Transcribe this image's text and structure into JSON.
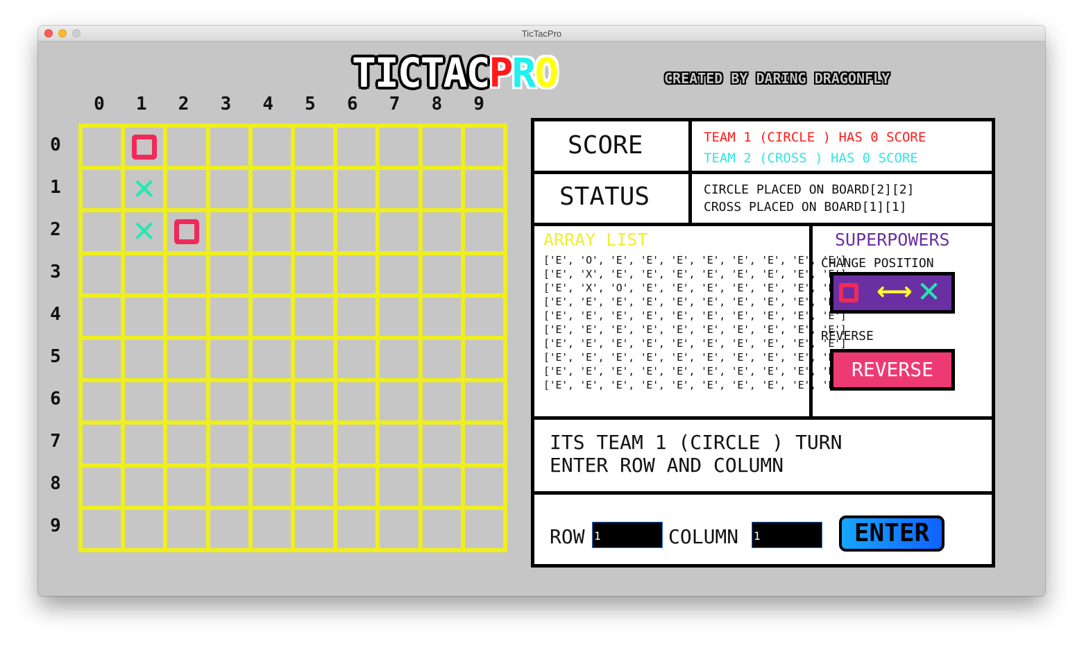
{
  "window": {
    "title": "TicTacPro"
  },
  "header": {
    "logo_tictac": "TICTAC",
    "logo_p": "P",
    "logo_r": "R",
    "logo_o": "O",
    "credit": "CREATED BY DARING DRAGONFLY"
  },
  "board": {
    "col_labels": [
      "0",
      "1",
      "2",
      "3",
      "4",
      "5",
      "6",
      "7",
      "8",
      "9"
    ],
    "row_labels": [
      "0",
      "1",
      "2",
      "3",
      "4",
      "5",
      "6",
      "7",
      "8",
      "9"
    ],
    "cells": [
      [
        "E",
        "O",
        "E",
        "E",
        "E",
        "E",
        "E",
        "E",
        "E",
        "E"
      ],
      [
        "E",
        "X",
        "E",
        "E",
        "E",
        "E",
        "E",
        "E",
        "E",
        "E"
      ],
      [
        "E",
        "X",
        "O",
        "E",
        "E",
        "E",
        "E",
        "E",
        "E",
        "E"
      ],
      [
        "E",
        "E",
        "E",
        "E",
        "E",
        "E",
        "E",
        "E",
        "E",
        "E"
      ],
      [
        "E",
        "E",
        "E",
        "E",
        "E",
        "E",
        "E",
        "E",
        "E",
        "E"
      ],
      [
        "E",
        "E",
        "E",
        "E",
        "E",
        "E",
        "E",
        "E",
        "E",
        "E"
      ],
      [
        "E",
        "E",
        "E",
        "E",
        "E",
        "E",
        "E",
        "E",
        "E",
        "E"
      ],
      [
        "E",
        "E",
        "E",
        "E",
        "E",
        "E",
        "E",
        "E",
        "E",
        "E"
      ],
      [
        "E",
        "E",
        "E",
        "E",
        "E",
        "E",
        "E",
        "E",
        "E",
        "E"
      ],
      [
        "E",
        "E",
        "E",
        "E",
        "E",
        "E",
        "E",
        "E",
        "E",
        "E"
      ]
    ],
    "grid_color": "#efef1e",
    "circle_color": "#ef2a5a",
    "cross_color": "#22e8b0"
  },
  "score": {
    "label": "SCORE",
    "team1": "TEAM 1 (CIRCLE ) HAS 0 SCORE",
    "team2": "TEAM 2 (CROSS ) HAS 0 SCORE"
  },
  "status": {
    "label": "STATUS",
    "line1": "CIRCLE PLACED ON BOARD[2][2]",
    "line2": "CROSS PLACED ON BOARD[1][1]"
  },
  "array_list": {
    "title": "ARRAY LIST",
    "rows": [
      "['E', 'O', 'E', 'E', 'E', 'E', 'E', 'E', 'E', 'E']",
      "['E', 'X', 'E', 'E', 'E', 'E', 'E', 'E', 'E', 'E']",
      "['E', 'X', 'O', 'E', 'E', 'E', 'E', 'E', 'E', 'E']",
      "['E', 'E', 'E', 'E', 'E', 'E', 'E', 'E', 'E', 'E']",
      "['E', 'E', 'E', 'E', 'E', 'E', 'E', 'E', 'E', 'E']",
      "['E', 'E', 'E', 'E', 'E', 'E', 'E', 'E', 'E', 'E']",
      "['E', 'E', 'E', 'E', 'E', 'E', 'E', 'E', 'E', 'E']",
      "['E', 'E', 'E', 'E', 'E', 'E', 'E', 'E', 'E', 'E']",
      "['E', 'E', 'E', 'E', 'E', 'E', 'E', 'E', 'E', 'E']",
      "['E', 'E', 'E', 'E', 'E', 'E', 'E', 'E', 'E', 'E']"
    ]
  },
  "superpowers": {
    "title": "SUPERPOWERS",
    "change_label": "CHANGE POSITION",
    "change_arrow": "⟷",
    "change_x": "✕",
    "reverse_label": "REVERSE",
    "reverse_button": "REVERSE"
  },
  "message": {
    "line1": "ITS TEAM 1 (CIRCLE ) TURN",
    "line2": "ENTER ROW AND COLUMN"
  },
  "inputs": {
    "row_label": "ROW",
    "row_value": "1",
    "column_label": "COLUMN",
    "column_value": "1",
    "enter_button": "ENTER"
  }
}
